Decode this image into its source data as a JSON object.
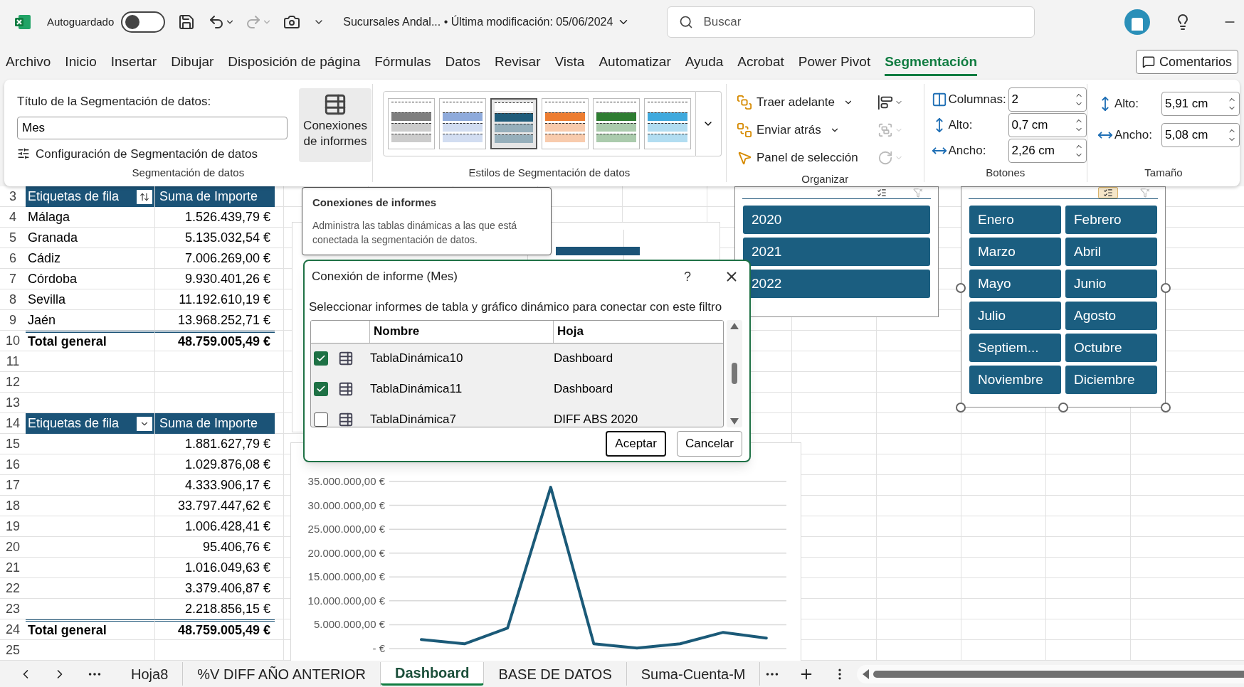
{
  "title_bar": {
    "autosave": {
      "label": "Autoguardado",
      "on": false
    },
    "document_title": "Sucursales Andal... • Última modificación: 05/06/2024",
    "search": {
      "placeholder": "Buscar"
    }
  },
  "menu_tabs": [
    {
      "label": "Archivo",
      "selected": false
    },
    {
      "label": "Inicio",
      "selected": false
    },
    {
      "label": "Insertar",
      "selected": false
    },
    {
      "label": "Dibujar",
      "selected": false
    },
    {
      "label": "Disposición de página",
      "selected": false
    },
    {
      "label": "Fórmulas",
      "selected": false
    },
    {
      "label": "Datos",
      "selected": false
    },
    {
      "label": "Revisar",
      "selected": false
    },
    {
      "label": "Vista",
      "selected": false
    },
    {
      "label": "Automatizar",
      "selected": false
    },
    {
      "label": "Ayuda",
      "selected": false
    },
    {
      "label": "Acrobat",
      "selected": false
    },
    {
      "label": "Power Pivot",
      "selected": false
    },
    {
      "label": "Segmentación",
      "selected": true
    }
  ],
  "comments_button": "Comentarios",
  "ribbon": {
    "slicer_group": {
      "caption_label": "Título de la Segmentación de datos:",
      "caption_value": "Mes",
      "settings_button": "Configuración de Segmentación de datos",
      "connections_button": "Conexiones de informes",
      "label": "Segmentación de datos"
    },
    "styles_group": {
      "styles": [
        {
          "color": "#7f7f7f",
          "selected": false
        },
        {
          "color": "#8eaadb",
          "selected": false
        },
        {
          "color": "#1f5c7a",
          "selected": true
        },
        {
          "color": "#ed7d31",
          "selected": false
        },
        {
          "color": "#2e7d32",
          "selected": false
        },
        {
          "color": "#3fa9dd",
          "selected": false
        }
      ],
      "label": "Estilos de Segmentación de datos"
    },
    "arrange_group": {
      "buttons": [
        "Traer adelante",
        "Enviar atrás",
        "Panel de selección"
      ],
      "icons": [
        {
          "kind": "align",
          "disabled": false
        },
        {
          "kind": "group",
          "disabled": true
        },
        {
          "kind": "rotate",
          "disabled": true
        }
      ],
      "label": "Organizar"
    },
    "buttons_group": {
      "fields": [
        {
          "label": "Columnas:",
          "value": "2"
        },
        {
          "label": "Alto:",
          "value": "0,7 cm"
        },
        {
          "label": "Ancho:",
          "value": "2,26 cm"
        }
      ],
      "label": "Botones"
    },
    "size_group": {
      "fields": [
        {
          "label": "Alto:",
          "value": "5,91 cm"
        },
        {
          "label": "Ancho:",
          "value": "5,08 cm"
        }
      ],
      "label": "Tamaño"
    }
  },
  "sheet": {
    "row_numbers": [
      "3",
      "4",
      "5",
      "6",
      "7",
      "8",
      "9",
      "10",
      "11",
      "12",
      "13",
      "14",
      "15",
      "16",
      "17",
      "18",
      "19",
      "20",
      "21",
      "22",
      "23",
      "24",
      "25"
    ],
    "pivot_1": {
      "header": [
        "Etiquetas de fila",
        "Suma de Importe"
      ],
      "rows": [
        [
          "Málaga",
          "1.526.439,79 €"
        ],
        [
          "Granada",
          "5.135.032,54 €"
        ],
        [
          "Cádiz",
          "7.006.269,00 €"
        ],
        [
          "Córdoba",
          "9.930.401,26 €"
        ],
        [
          "Sevilla",
          "11.192.610,19 €"
        ],
        [
          "Jaén",
          "13.968.252,71 €"
        ]
      ],
      "total": [
        "Total general",
        "48.759.005,49 €"
      ]
    },
    "pivot_2": {
      "header": [
        "Etiquetas de fila",
        "Suma de Importe"
      ],
      "rows": [
        "1.881.627,79 €",
        "1.029.876,08 €",
        "4.333.906,17 €",
        "33.797.447,62 €",
        "1.006.428,41 €",
        "95.406,76 €",
        "1.016.049,63 €",
        "3.379.406,87 €",
        "2.218.856,15 €"
      ],
      "total": [
        "Total general",
        "48.759.005,49 €"
      ]
    },
    "year_slicer": {
      "multi_select": false,
      "items": [
        {
          "label": "2020",
          "selected": true
        },
        {
          "label": "2021",
          "selected": true
        },
        {
          "label": "2022",
          "selected": true
        }
      ]
    },
    "month_slicer": {
      "multi_select": true,
      "items": [
        {
          "label": "Enero",
          "selected": true
        },
        {
          "label": "Febrero",
          "selected": true
        },
        {
          "label": "Marzo",
          "selected": true
        },
        {
          "label": "Abril",
          "selected": true
        },
        {
          "label": "Mayo",
          "selected": true
        },
        {
          "label": "Junio",
          "selected": true
        },
        {
          "label": "Julio",
          "selected": true
        },
        {
          "label": "Agosto",
          "selected": true
        },
        {
          "label": "Septiem...",
          "selected": true
        },
        {
          "label": "Octubre",
          "selected": true
        },
        {
          "label": "Noviembre",
          "selected": true
        },
        {
          "label": "Diciembre",
          "selected": true
        }
      ]
    },
    "line_chart": {
      "chart_data": {
        "type": "line",
        "grid": true,
        "series": [
          {
            "color": "#1b5a78",
            "values": [
              1900000,
              1000000,
              4300000,
              33800000,
              1000000,
              100000,
              1000000,
              3400000,
              2200000
            ]
          }
        ],
        "ylim": [
          0,
          35000000
        ],
        "yticks": [
          {
            "value": 0,
            "label": "- €"
          },
          {
            "value": 5000000,
            "label": "5.000.000,00 €"
          },
          {
            "value": 10000000,
            "label": "10.000.000,00 €"
          },
          {
            "value": 15000000,
            "label": "15.000.000,00 €"
          },
          {
            "value": 20000000,
            "label": "20.000.000,00 €"
          },
          {
            "value": 25000000,
            "label": "25.000.000,00 €"
          },
          {
            "value": 30000000,
            "label": "30.000.000,00 €"
          },
          {
            "value": 35000000,
            "label": "35.000.000,00 €"
          }
        ]
      }
    },
    "tooltip": {
      "title": "Conexiones de informes",
      "text": "Administra las tablas dinámicas a las que está conectada la segmentación de datos."
    },
    "dialog": {
      "title": "Conexión de informe (Mes)",
      "help": "?",
      "instruction": "Seleccionar informes de tabla y gráfico dinámico para conectar con este filtro",
      "columns": [
        "Nombre",
        "Hoja"
      ],
      "rows": [
        {
          "name": "TablaDinámica10",
          "sheet": "Dashboard",
          "checked": true
        },
        {
          "name": "TablaDinámica11",
          "sheet": "Dashboard",
          "checked": true
        },
        {
          "name": "TablaDinámica7",
          "sheet": "DIFF ABS 2020",
          "checked": false
        }
      ],
      "buttons": [
        "Aceptar",
        "Cancelar"
      ]
    }
  },
  "sheet_tabs": [
    {
      "label": "Hoja8",
      "selected": false
    },
    {
      "label": "%V DIFF AÑO ANTERIOR",
      "selected": false
    },
    {
      "label": "Dashboard",
      "selected": true
    },
    {
      "label": "BASE DE DATOS",
      "selected": false
    },
    {
      "label": "Suma-Cuenta-M",
      "selected": false
    }
  ]
}
